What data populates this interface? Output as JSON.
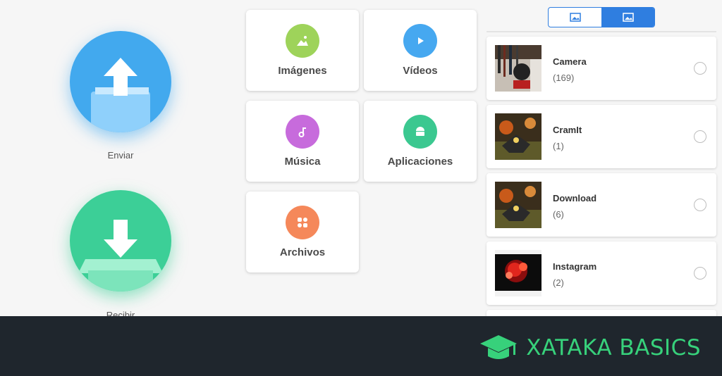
{
  "left_panel": {
    "send_label": "Enviar",
    "receive_label": "Recibir"
  },
  "categories": [
    {
      "label": "Imágenes",
      "icon": "image-icon",
      "color": "#9ed35a"
    },
    {
      "label": "Vídeos",
      "icon": "play-icon",
      "color": "#46a8f0"
    },
    {
      "label": "Música",
      "icon": "music-note-icon",
      "color": "#c76bdc"
    },
    {
      "label": "Aplicaciones",
      "icon": "android-icon",
      "color": "#3bc890"
    },
    {
      "label": "Archivos",
      "icon": "files-grid-icon",
      "color": "#f5885a"
    }
  ],
  "view_toggle": {
    "options": [
      "image-view-icon",
      "gallery-view-icon"
    ],
    "selected": "gallery-view-icon",
    "accent": "#2f7ee0"
  },
  "albums": [
    {
      "name": "Camera",
      "count": "(169)"
    },
    {
      "name": "CramIt",
      "count": "(1)"
    },
    {
      "name": "Download",
      "count": "(6)"
    },
    {
      "name": "Instagram",
      "count": "(2)"
    }
  ],
  "footer": {
    "brand": "XATAKA BASICS",
    "brand_color": "#37d17b"
  }
}
